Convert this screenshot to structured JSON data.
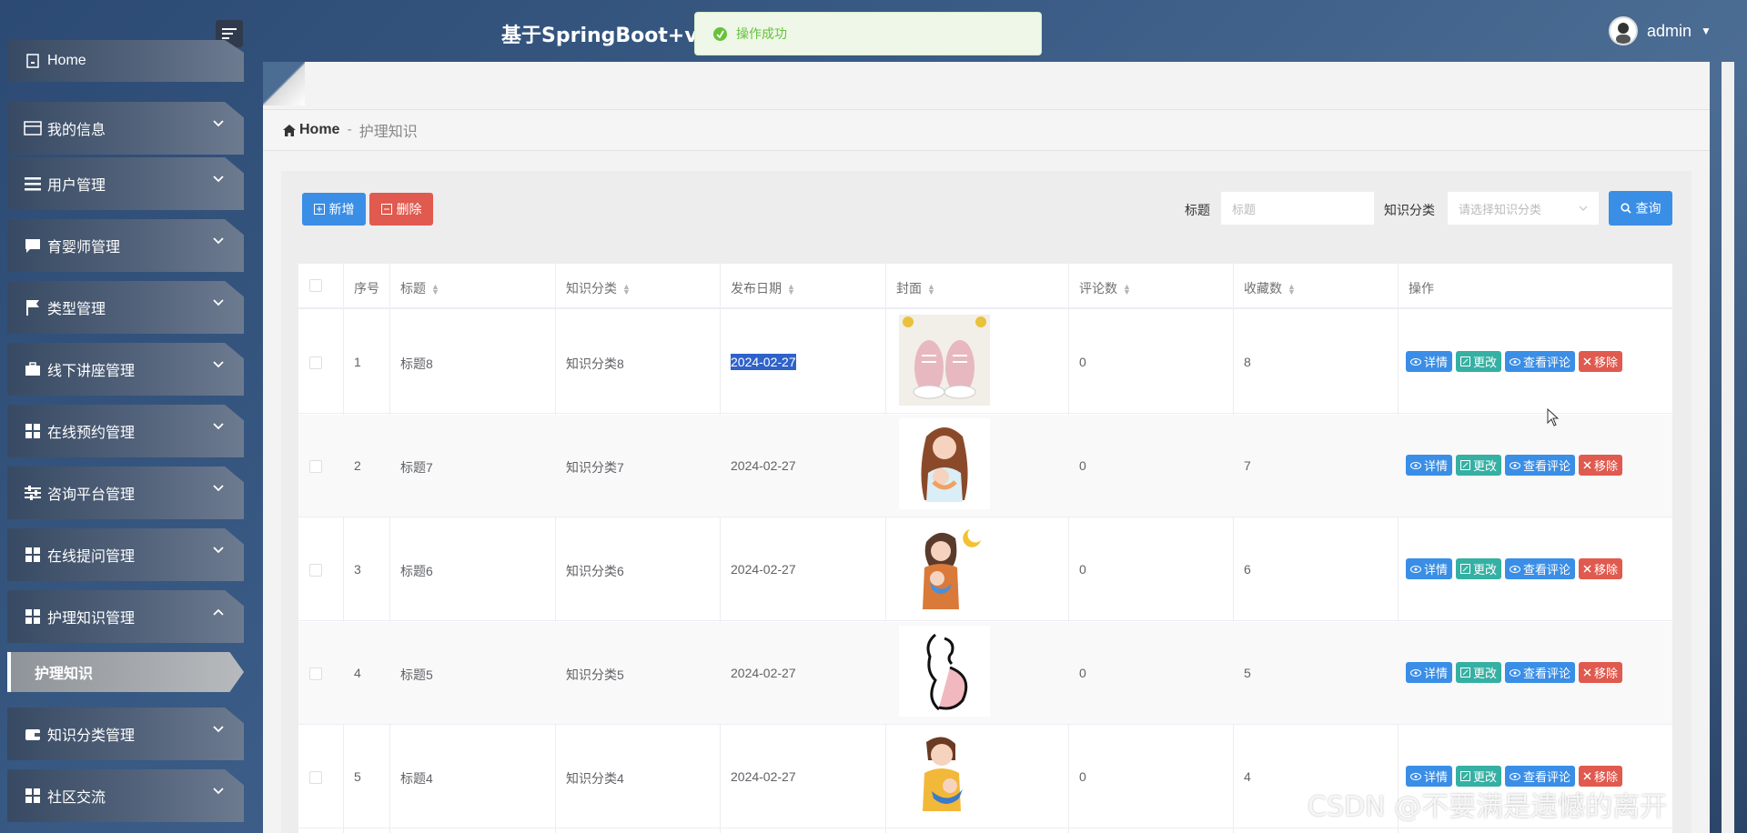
{
  "header": {
    "title": "基于SpringBoot+vue",
    "toast": "操作成功",
    "user": "admin"
  },
  "sidebar": {
    "items": [
      {
        "label": "Home",
        "icon": "home-icon"
      },
      {
        "label": "我的信息",
        "icon": "card-icon"
      },
      {
        "label": "用户管理",
        "icon": "list-icon"
      },
      {
        "label": "育婴师管理",
        "icon": "chat-icon"
      },
      {
        "label": "类型管理",
        "icon": "flag-icon"
      },
      {
        "label": "线下讲座管理",
        "icon": "briefcase-icon"
      },
      {
        "label": "在线预约管理",
        "icon": "grid-icon"
      },
      {
        "label": "咨询平台管理",
        "icon": "sliders-icon"
      },
      {
        "label": "在线提问管理",
        "icon": "grid-icon"
      },
      {
        "label": "护理知识管理",
        "icon": "grid-icon"
      },
      {
        "label": "知识分类管理",
        "icon": "wallet-icon"
      },
      {
        "label": "社区交流",
        "icon": "grid-icon"
      }
    ],
    "active_sub": "护理知识"
  },
  "breadcrumb": {
    "home": "Home",
    "separator": "-",
    "current": "护理知识"
  },
  "toolbar": {
    "add_label": "新增",
    "delete_label": "删除",
    "title_label": "标题",
    "title_placeholder": "标题",
    "category_label": "知识分类",
    "category_placeholder": "请选择知识分类",
    "query_label": "查询"
  },
  "table": {
    "headers": {
      "index": "序号",
      "title": "标题",
      "category": "知识分类",
      "date": "发布日期",
      "cover": "封面",
      "comments": "评论数",
      "favorites": "收藏数",
      "actions": "操作"
    },
    "actions": {
      "detail": "详情",
      "edit": "更改",
      "comments": "查看评论",
      "remove": "移除"
    },
    "rows": [
      {
        "index": "1",
        "title": "标题8",
        "category": "知识分类8",
        "date": "2024-02-27",
        "comments": "0",
        "favorites": "8",
        "cover": "baby-shoes"
      },
      {
        "index": "2",
        "title": "标题7",
        "category": "知识分类7",
        "date": "2024-02-27",
        "comments": "0",
        "favorites": "7",
        "cover": "mother-baby"
      },
      {
        "index": "3",
        "title": "标题6",
        "category": "知识分类6",
        "date": "2024-02-27",
        "comments": "0",
        "favorites": "6",
        "cover": "mother-moon"
      },
      {
        "index": "4",
        "title": "标题5",
        "category": "知识分类5",
        "date": "2024-02-27",
        "comments": "0",
        "favorites": "5",
        "cover": "pregnant-line"
      },
      {
        "index": "5",
        "title": "标题4",
        "category": "知识分类4",
        "date": "2024-02-27",
        "comments": "0",
        "favorites": "4",
        "cover": "mother-feeding"
      }
    ]
  },
  "watermark": "CSDN @不要满是遗憾的离开"
}
